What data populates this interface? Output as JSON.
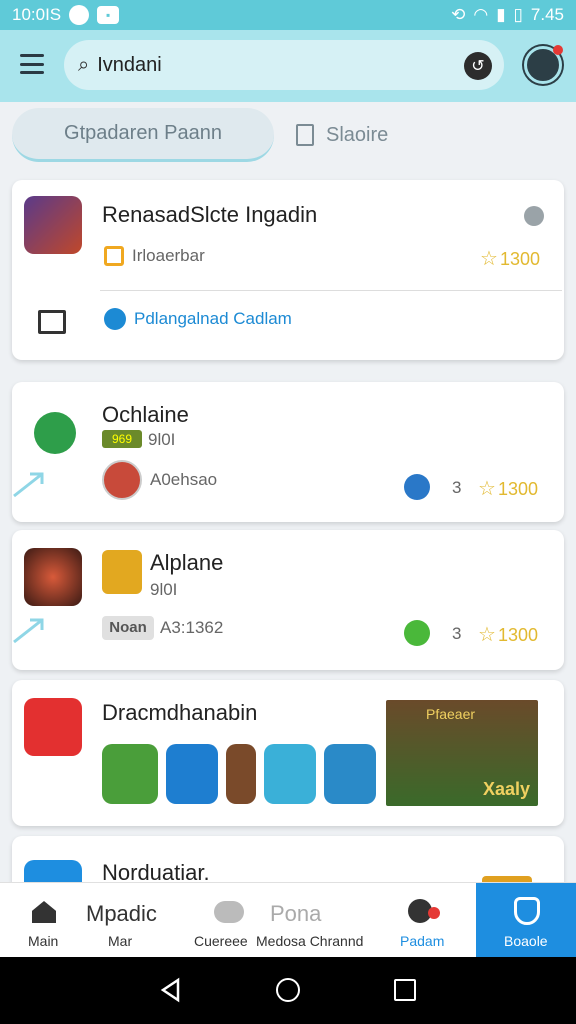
{
  "status_bar": {
    "time": "10:0IS",
    "right_time": "7.45"
  },
  "search": {
    "query": "Ivndani"
  },
  "tabs": [
    {
      "label": "Gtpadaren Paann"
    },
    {
      "label": "Slaoire"
    }
  ],
  "cards": [
    {
      "title": "RenasadSlcte Ingadin",
      "subtitle": "Irloaerbar",
      "rating": "1300",
      "action_label": "Pdlangalnad Cadlam"
    },
    {
      "title": "Ochlaine",
      "badge": "969",
      "meta": "9l0I",
      "author": "A0ehsao",
      "count": "3",
      "rating": "1300"
    },
    {
      "title": "Alplane",
      "meta": "9l0I",
      "tag": "Noan",
      "code": "A3:1362",
      "count": "3",
      "rating": "1300"
    },
    {
      "title": "Dracmdhanabin",
      "banner_text": "Xaaly",
      "banner_header": "Pfaeaer"
    },
    {
      "title": "Norduatiar."
    }
  ],
  "bottom_nav": [
    {
      "label": "Main",
      "icon": "home-icon"
    },
    {
      "label": "Mpadic",
      "sub": "Mar"
    },
    {
      "label": "Cuereee",
      "icon": "people-icon"
    },
    {
      "label": "Pona",
      "sub": "Medosa Chrannd"
    },
    {
      "label": "Padam",
      "icon": "record-icon"
    },
    {
      "label": "Boaole",
      "icon": "shield-icon"
    }
  ],
  "colors": {
    "accent": "#5fcad8",
    "appbar": "#a9e4ec",
    "blue_link": "#1c8ad4",
    "star": "#e2b930",
    "nav_active": "#1e8ee0"
  }
}
